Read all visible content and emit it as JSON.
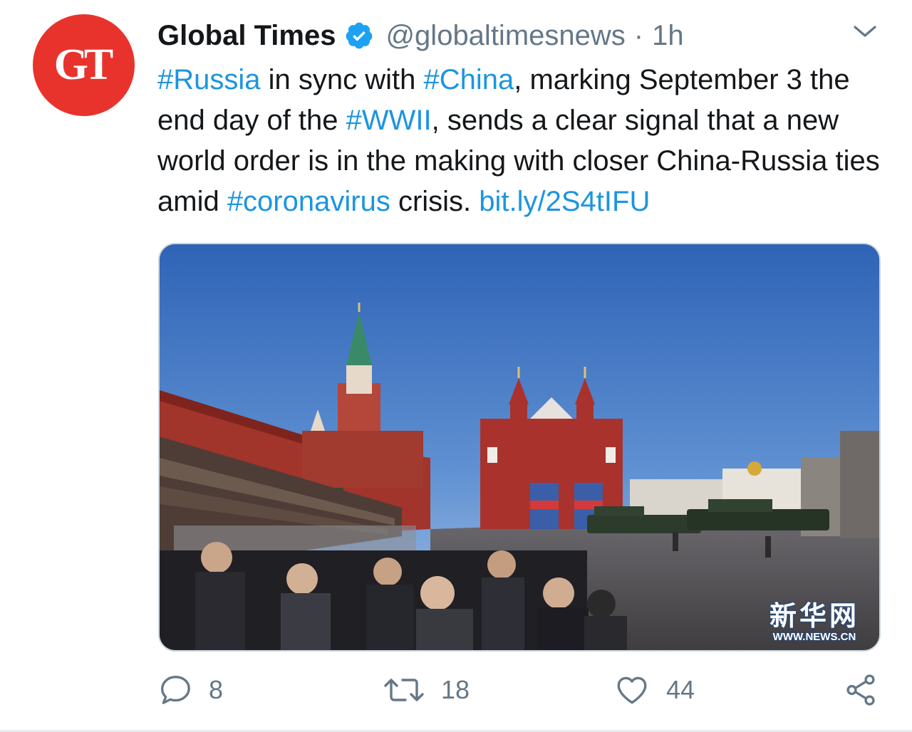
{
  "tweet": {
    "avatar_text": "GT",
    "display_name": "Global Times",
    "handle": "@globaltimesnews",
    "separator": "·",
    "timestamp": "1h",
    "body": {
      "seg1": "#Russia",
      "seg2": " in sync with ",
      "seg3": "#China",
      "seg4": ", marking September 3 the end day of the ",
      "seg5": "#WWII",
      "seg6": ", sends a clear signal that a new world order is in the making with closer China-Russia ties amid ",
      "seg7": "#coronavirus",
      "seg8": " crisis. ",
      "seg9": "bit.ly/2S4tIFU"
    },
    "media": {
      "watermark_cn": "新华网",
      "watermark_url": "WWW.NEWS.CN"
    },
    "actions": {
      "replies": "8",
      "retweets": "18",
      "likes": "44"
    }
  },
  "colors": {
    "link": "#1b95e0",
    "secondary_text": "#657786",
    "verified_badge": "#1da1f2",
    "avatar_bg": "#e8332c",
    "media_border": "#ccd6dd"
  },
  "icons": {
    "verified": "verified-badge-icon",
    "menu": "chevron-down-icon",
    "reply": "reply-icon",
    "retweet": "retweet-icon",
    "like": "heart-icon",
    "share": "share-icon"
  }
}
